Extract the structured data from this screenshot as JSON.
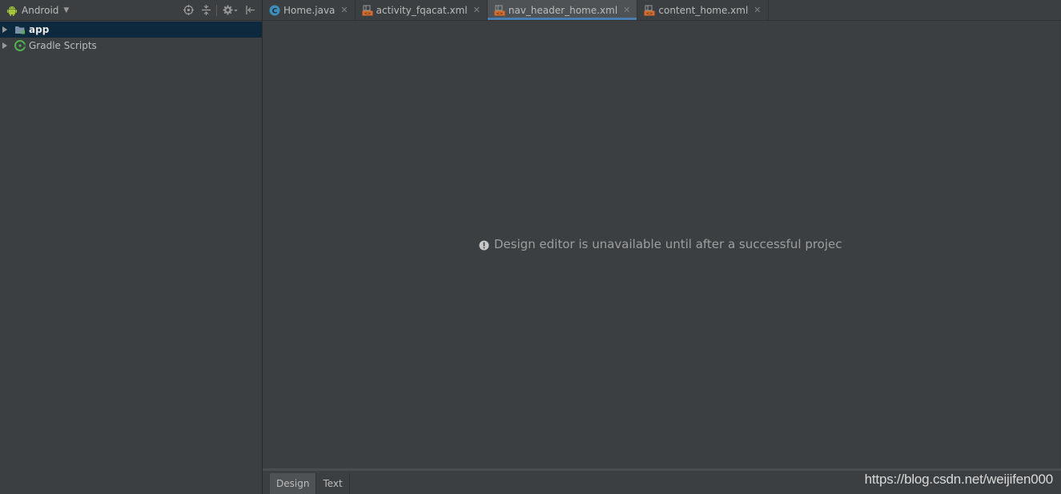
{
  "project_panel": {
    "view_selector": "Android",
    "tools": [
      {
        "icon": "locate-icon"
      },
      {
        "icon": "collapse-all-icon"
      },
      {
        "icon": "gear-icon"
      },
      {
        "icon": "hide-panel-icon"
      }
    ],
    "tree": [
      {
        "label": "app",
        "icon": "folder-module-icon",
        "selected": true
      },
      {
        "label": "Gradle Scripts",
        "icon": "gradle-icon",
        "selected": false
      }
    ]
  },
  "editor": {
    "tabs": [
      {
        "label": "Home.java",
        "icon": "java-class-icon",
        "active": false
      },
      {
        "label": "activity_fqacat.xml",
        "icon": "xml-layout-icon",
        "active": false
      },
      {
        "label": "nav_header_home.xml",
        "icon": "xml-layout-icon",
        "active": true
      },
      {
        "label": "content_home.xml",
        "icon": "xml-layout-icon",
        "active": false
      }
    ],
    "message": "Design editor is unavailable until after a successful project sync",
    "bottom_tabs": [
      {
        "label": "Design",
        "active": true
      },
      {
        "label": "Text",
        "active": false
      }
    ]
  },
  "watermark": "https://blog.csdn.net/weijifen000",
  "colors": {
    "background": "#3c3f41",
    "selection": "#0d293e",
    "active_tab": "#4e5254",
    "tab_underline": "#4a88c7",
    "android_green": "#a4c639",
    "java_class": "#3d8eb9",
    "xml_orange": "#d46b2a"
  }
}
